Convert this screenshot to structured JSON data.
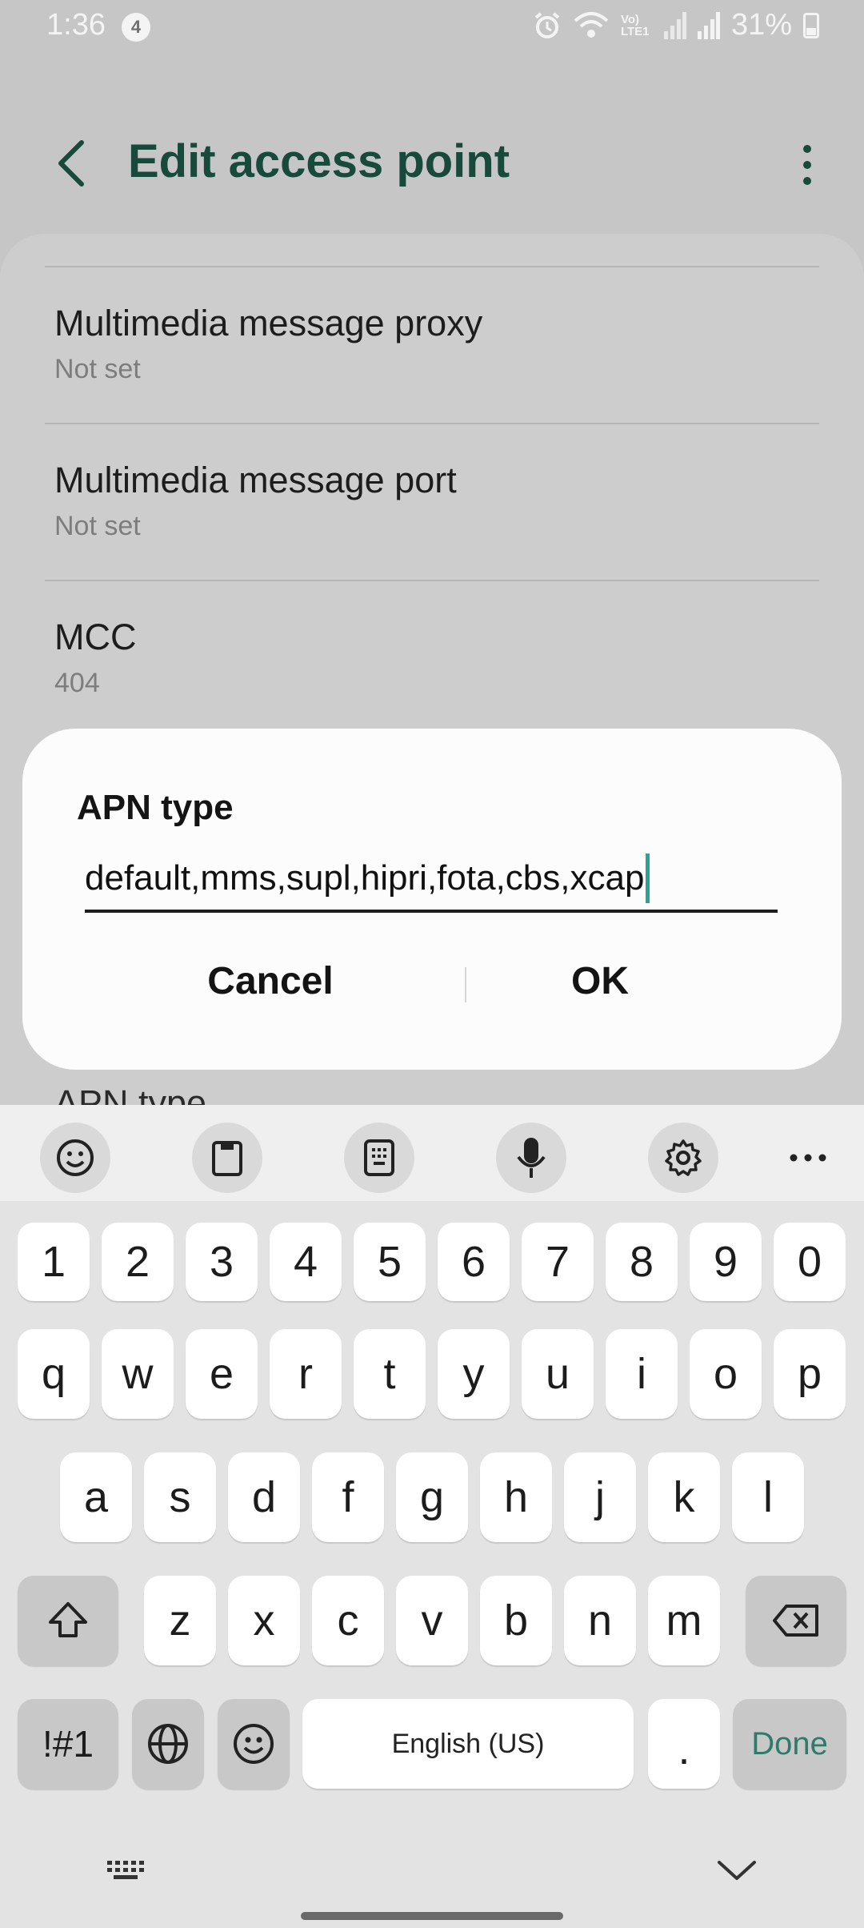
{
  "status_bar": {
    "time": "1:36",
    "notification_count": "4",
    "network_label": "Vo) LTE1",
    "battery": "31%",
    "icons": [
      "alarm-icon",
      "wifi-icon",
      "volte-icon",
      "signal-icon",
      "signal-icon",
      "battery-icon"
    ]
  },
  "app_bar": {
    "title": "Edit access point",
    "back_icon": "chevron-left-icon",
    "more_icon": "more-vertical-icon",
    "accent_color": "#174a3a"
  },
  "settings": {
    "items": [
      {
        "title": "Multimedia message proxy",
        "value": "Not set"
      },
      {
        "title": "Multimedia message port",
        "value": "Not set"
      },
      {
        "title": "MCC",
        "value": "404"
      }
    ],
    "partially_visible_title": "APN type"
  },
  "dialog": {
    "title": "APN type",
    "input_value": "default,mms,supl,hipri,fota,cbs,xcap",
    "cancel_label": "Cancel",
    "ok_label": "OK",
    "caret_color": "#2aa394"
  },
  "keyboard": {
    "toolbar_icons": [
      "emoji-icon",
      "clipboard-icon",
      "keypad-icon",
      "microphone-icon",
      "settings-icon",
      "more-horizontal-icon"
    ],
    "row_numbers": [
      "1",
      "2",
      "3",
      "4",
      "5",
      "6",
      "7",
      "8",
      "9",
      "0"
    ],
    "row_top": [
      "q",
      "w",
      "e",
      "r",
      "t",
      "y",
      "u",
      "i",
      "o",
      "p"
    ],
    "row_middle": [
      "a",
      "s",
      "d",
      "f",
      "g",
      "h",
      "j",
      "k",
      "l"
    ],
    "row_bottom": [
      "z",
      "x",
      "c",
      "v",
      "b",
      "n",
      "m"
    ],
    "symbols_label": "!#1",
    "space_label": "English (US)",
    "period_label": ".",
    "done_label": "Done",
    "done_color": "#2e7b6a"
  },
  "nav_bar": {
    "icons": [
      "keyboard-switch-icon",
      "chevron-down-icon",
      "home-handle"
    ]
  }
}
